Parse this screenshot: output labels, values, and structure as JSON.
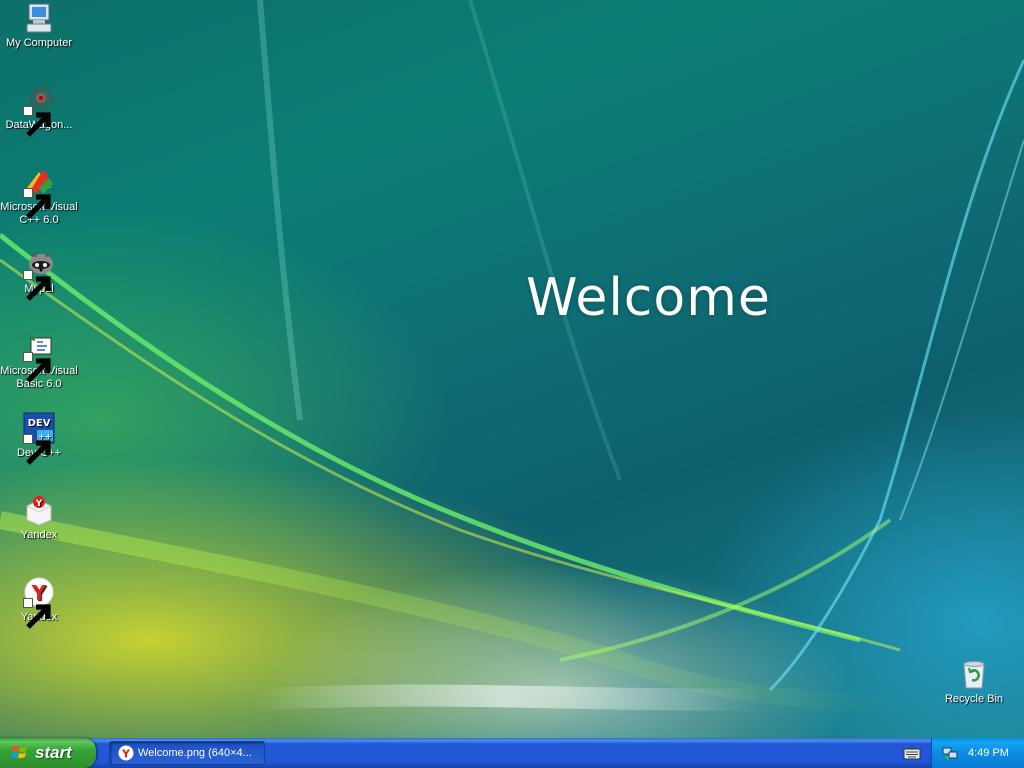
{
  "wallpaper": {
    "heading": "Welcome"
  },
  "desktop_icons": [
    {
      "label": "My Computer",
      "icon": "my-computer-icon",
      "shortcut": false
    },
    {
      "label": "DataWagon...",
      "icon": "datawagon-icon",
      "shortcut": true
    },
    {
      "label": "Microsoft Visual C++ 6.0",
      "icon": "visual-cpp-icon",
      "shortcut": true
    },
    {
      "label": "Mypal",
      "icon": "mypal-icon",
      "shortcut": true
    },
    {
      "label": "Microsoft Visual Basic 6.0",
      "icon": "visual-basic-icon",
      "shortcut": true
    },
    {
      "label": "Dev-C++",
      "icon": "dev-cpp-icon",
      "shortcut": true
    },
    {
      "label": "Yandex",
      "icon": "yandex-installer-icon",
      "shortcut": false
    },
    {
      "label": "Yandex",
      "icon": "yandex-browser-icon",
      "shortcut": true
    }
  ],
  "recycle_bin": {
    "label": "Recycle Bin",
    "icon": "recycle-bin-icon"
  },
  "taskbar": {
    "start_label": "start",
    "tasks": [
      {
        "label": "Welcome.png (640×4...",
        "icon": "yandex-browser-icon"
      }
    ],
    "tray": {
      "time": "4:49 PM",
      "icons": [
        "keyboard-icon",
        "network-icon"
      ]
    }
  },
  "colors": {
    "taskbar_blue": "#2157d7",
    "start_green": "#36a336",
    "tray_blue": "#0b8ee3",
    "welcome_text": "#ffffff"
  }
}
